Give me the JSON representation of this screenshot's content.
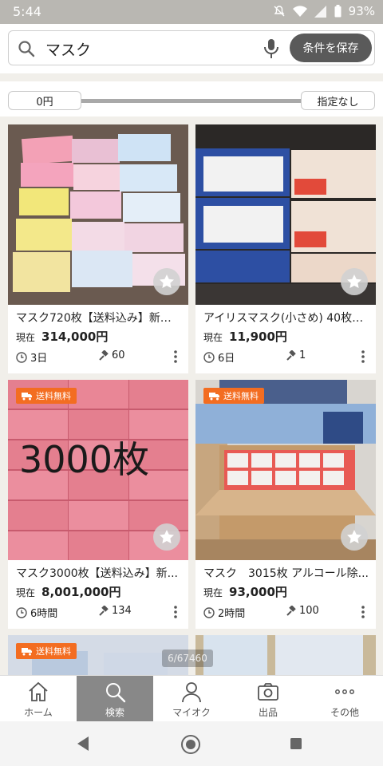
{
  "status_bar": {
    "time": "5:44",
    "battery": "93%"
  },
  "search": {
    "query": "マスク",
    "save_label": "条件を保存"
  },
  "price_filter": {
    "min_label": "0円",
    "max_label": "指定なし"
  },
  "listings": [
    {
      "title": "マスク720枚【送料込み】新品...",
      "price_prefix": "現在",
      "price": "314,000円",
      "time_left": "3日",
      "bids": "60",
      "free_shipping": false
    },
    {
      "title": "アイリスマスク(小さめ) 40枚二...",
      "price_prefix": "現在",
      "price": "11,900円",
      "time_left": "6日",
      "bids": "1",
      "free_shipping": false
    },
    {
      "title": "マスク3000枚【送料込み】新...",
      "price_prefix": "現在",
      "price": "8,001,000円",
      "time_left": "6時間",
      "bids": "134",
      "free_shipping": true,
      "overlay_text": "3000枚"
    },
    {
      "title": "マスク　3015枚 アルコール除...",
      "price_prefix": "現在",
      "price": "93,000円",
      "time_left": "2時間",
      "bids": "100",
      "free_shipping": true
    }
  ],
  "partial_listings": [
    {
      "free_shipping": true
    },
    {
      "free_shipping": false
    }
  ],
  "badge_label": "送料無料",
  "image_counter": "6/67460",
  "bottom_nav": [
    {
      "label": "ホーム",
      "icon": "home-icon"
    },
    {
      "label": "検索",
      "icon": "search-icon",
      "active": true
    },
    {
      "label": "マイオク",
      "icon": "person-icon"
    },
    {
      "label": "出品",
      "icon": "camera-icon"
    },
    {
      "label": "その他",
      "icon": "more-dots-icon"
    }
  ],
  "colors": {
    "accent_orange": "#f36d21",
    "save_button": "#5a5a5a",
    "active_nav": "#888888"
  }
}
